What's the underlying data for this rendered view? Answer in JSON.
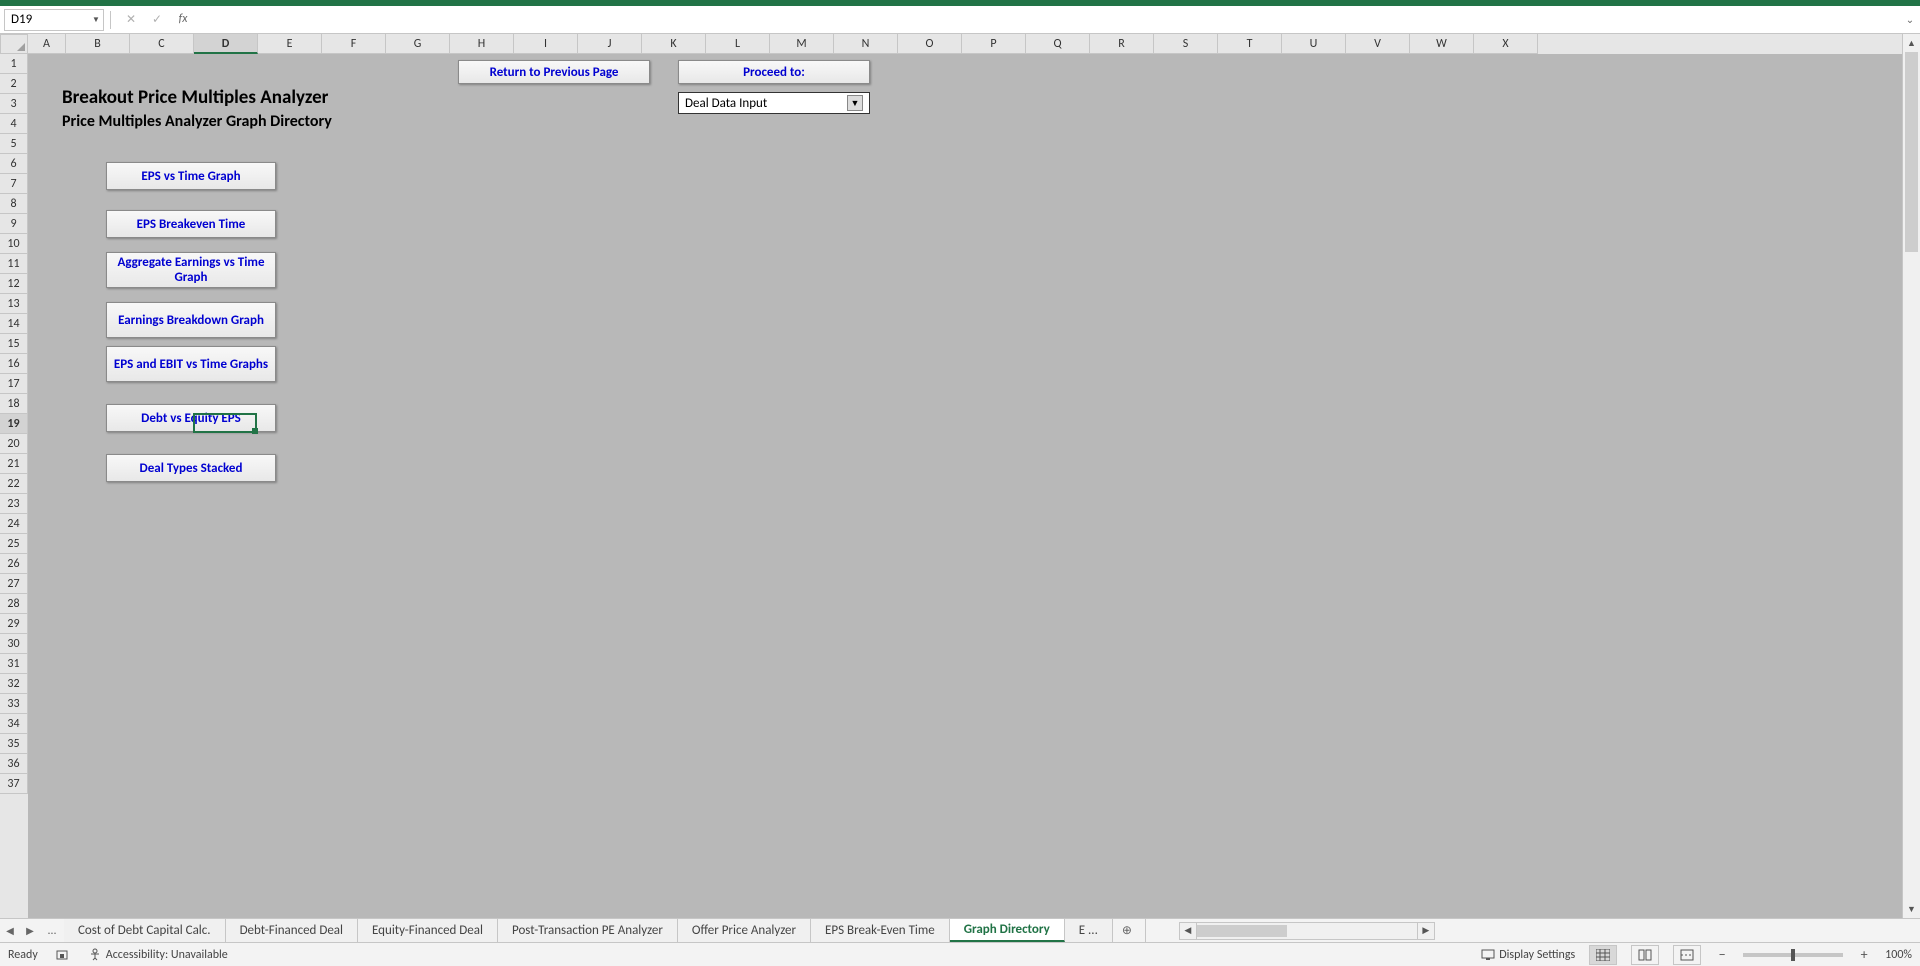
{
  "name_box": "D19",
  "formula": "",
  "columns": [
    "A",
    "B",
    "C",
    "D",
    "E",
    "F",
    "G",
    "H",
    "I",
    "J",
    "K",
    "L",
    "M",
    "N",
    "O",
    "P",
    "Q",
    "R",
    "S",
    "T",
    "U",
    "V",
    "W",
    "X"
  ],
  "active_col": "D",
  "active_row": 19,
  "row_count": 37,
  "col_width_first": 38,
  "col_width_default": 64,
  "sheet": {
    "title": "Breakout Price Multiples Analyzer",
    "subtitle": "Price Multiples Analyzer Graph Directory",
    "nav_buttons": {
      "return": "Return to Previous Page",
      "proceed_label": "Proceed to:",
      "proceed_value": "Deal Data Input"
    },
    "graph_buttons": [
      "EPS vs Time Graph",
      "EPS Breakeven Time",
      "Aggregate Earnings vs Time Graph",
      "Earnings Breakdown Graph",
      "EPS and EBIT  vs Time Graphs",
      "Debt vs Equity EPS",
      "Deal Types Stacked"
    ]
  },
  "tabs": [
    "Cost of Debt Capital Calc.",
    "Debt-Financed Deal",
    "Equity-Financed Deal",
    "Post-Transaction PE Analyzer",
    "Offer Price Analyzer",
    "EPS Break-Even Time",
    "Graph Directory",
    "E ..."
  ],
  "active_tab": "Graph Directory",
  "status": {
    "ready": "Ready",
    "accessibility": "Accessibility: Unavailable",
    "display_settings": "Display Settings",
    "zoom": "100%"
  }
}
